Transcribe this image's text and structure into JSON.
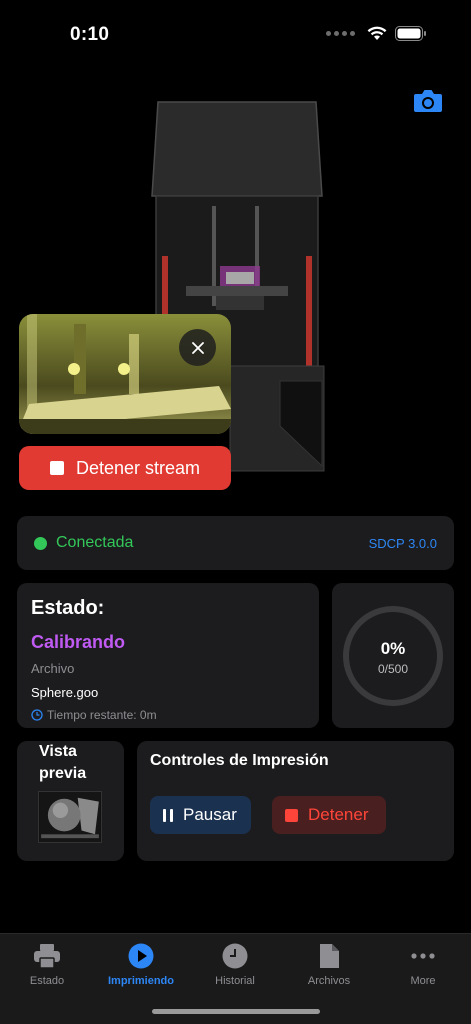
{
  "status_bar": {
    "time": "0:10"
  },
  "stream": {
    "stop_label": "Detener stream"
  },
  "connection": {
    "status": "Conectada",
    "protocol": "SDCP 3.0.0",
    "status_color": "#33c759"
  },
  "status_card": {
    "title": "Estado:",
    "state": "Calibrando",
    "file_label": "Archivo",
    "file_name": "Sphere.goo",
    "remaining": "Tiempo restante: 0m"
  },
  "progress": {
    "percent_label": "0%",
    "layers": "0/500",
    "fraction": 0
  },
  "preview": {
    "title": "Vista previa"
  },
  "controls": {
    "title": "Controles de Impresión",
    "pause_label": "Pausar",
    "stop_label": "Detener"
  },
  "tabs": [
    {
      "label": "Estado",
      "icon": "printer-icon"
    },
    {
      "label": "Imprimiendo",
      "icon": "play-circle-icon",
      "active": true
    },
    {
      "label": "Historial",
      "icon": "clock-icon"
    },
    {
      "label": "Archivos",
      "icon": "document-icon"
    },
    {
      "label": "More",
      "icon": "ellipsis-icon"
    }
  ],
  "colors": {
    "accent": "#2d86f5",
    "danger": "#e13a32",
    "state": "#bf5af2"
  }
}
